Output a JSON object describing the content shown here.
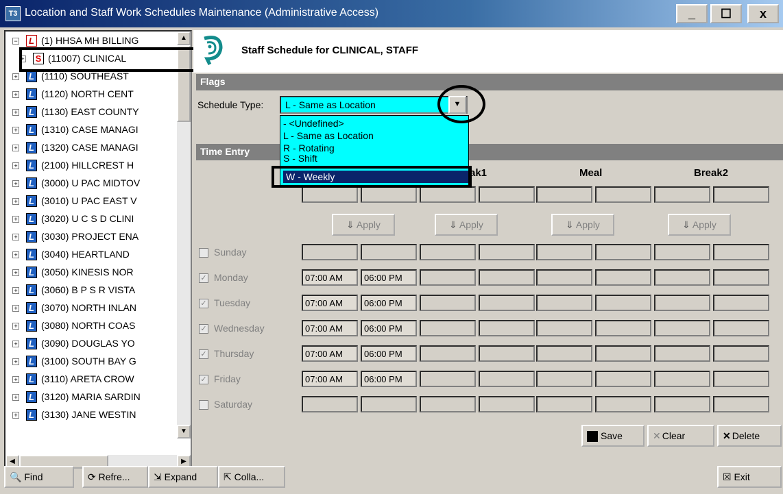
{
  "window": {
    "icon_label": "T3",
    "title": "Location and Staff Work Schedules Maintenance (Administrative Access)",
    "minimize": "_",
    "maximize": "☐",
    "close": "x"
  },
  "tree": {
    "items": [
      {
        "badge": "L",
        "label": "(1) HHSA MH BILLING"
      },
      {
        "badge": "S",
        "label": "(11007) CLINICAL"
      },
      {
        "badge": "L",
        "label": "(1110) SOUTHEAST"
      },
      {
        "badge": "L",
        "label": "(1120) NORTH CENT"
      },
      {
        "badge": "L",
        "label": "(1130) EAST COUNTY"
      },
      {
        "badge": "L",
        "label": "(1310) CASE MANAGI"
      },
      {
        "badge": "L",
        "label": "(1320) CASE MANAGI"
      },
      {
        "badge": "L",
        "label": "(2100) HILLCREST H"
      },
      {
        "badge": "L",
        "label": "(3000) U PAC MIDTOV"
      },
      {
        "badge": "L",
        "label": "(3010) U PAC EAST V"
      },
      {
        "badge": "L",
        "label": "(3020) U C S D CLINI"
      },
      {
        "badge": "L",
        "label": "(3030) PROJECT ENA"
      },
      {
        "badge": "L",
        "label": "(3040) HEARTLAND"
      },
      {
        "badge": "L",
        "label": "(3050) KINESIS NOR"
      },
      {
        "badge": "L",
        "label": "(3060) B P S R VISTA"
      },
      {
        "badge": "L",
        "label": "(3070) NORTH INLAN"
      },
      {
        "badge": "L",
        "label": "(3080) NORTH COAS"
      },
      {
        "badge": "L",
        "label": "(3090) DOUGLAS YO"
      },
      {
        "badge": "L",
        "label": "(3100) SOUTH BAY G"
      },
      {
        "badge": "L",
        "label": "(3110) ARETA CROW"
      },
      {
        "badge": "L",
        "label": "(3120) MARIA SARDIN"
      },
      {
        "badge": "L",
        "label": "(3130) JANE WESTIN"
      }
    ]
  },
  "header": {
    "title": "Staff Schedule for CLINICAL, STAFF"
  },
  "flags": {
    "section_title": "Flags",
    "schedule_type_label": "Schedule Type:",
    "schedule_type_value": "L - Same as Location",
    "options": [
      "- <Undefined>",
      "L - Same as Location",
      "R - Rotating",
      "S - Shift",
      "W - Weekly"
    ]
  },
  "time_entry": {
    "section_title": "Time Entry",
    "columns": [
      "ak1",
      "Meal",
      "Break2"
    ],
    "apply_label": "Apply",
    "days": [
      {
        "name": "Sunday",
        "checked": false,
        "start": "",
        "end": ""
      },
      {
        "name": "Monday",
        "checked": true,
        "start": "07:00 AM",
        "end": "06:00 PM"
      },
      {
        "name": "Tuesday",
        "checked": true,
        "start": "07:00 AM",
        "end": "06:00 PM"
      },
      {
        "name": "Wednesday",
        "checked": true,
        "start": "07:00 AM",
        "end": "06:00 PM"
      },
      {
        "name": "Thursday",
        "checked": true,
        "start": "07:00 AM",
        "end": "06:00 PM"
      },
      {
        "name": "Friday",
        "checked": true,
        "start": "07:00 AM",
        "end": "06:00 PM"
      },
      {
        "name": "Saturday",
        "checked": false,
        "start": "",
        "end": ""
      }
    ]
  },
  "actions": {
    "save": "Save",
    "clear": "Clear",
    "delete": "Delete"
  },
  "bottom": {
    "find": "Find",
    "refresh": "Refre...",
    "expand": "Expand",
    "collapse": "Colla...",
    "exit": "Exit"
  },
  "colors": {
    "titlebar": "#0a246a",
    "select_bg": "#00ffff",
    "section_bar": "#808080"
  }
}
